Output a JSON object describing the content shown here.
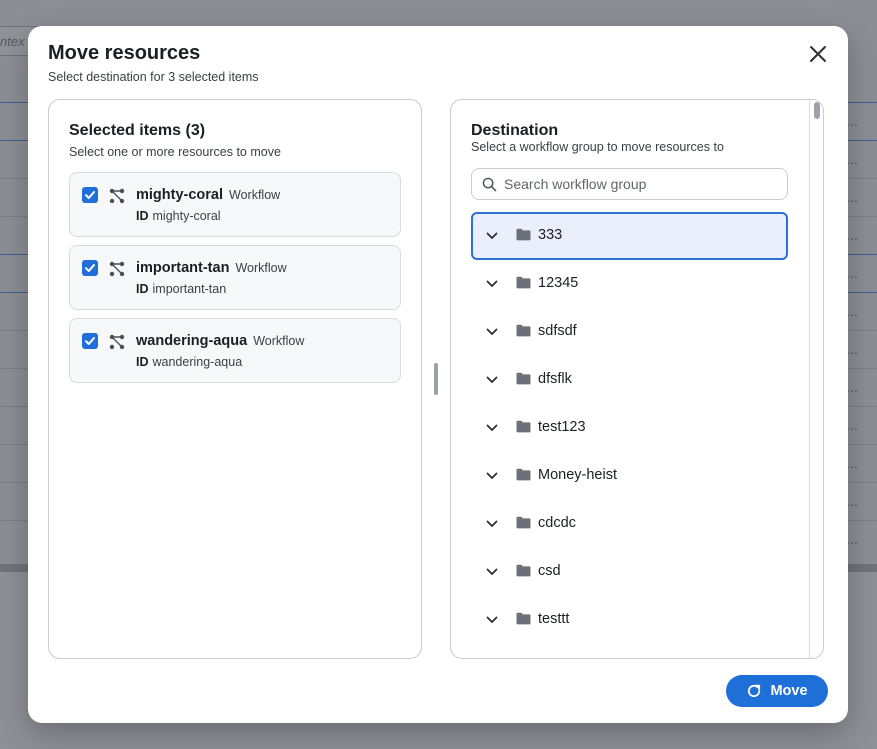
{
  "background": {
    "filter_text": "ntex"
  },
  "modal": {
    "title": "Move resources",
    "subtitle": "Select destination for 3 selected items",
    "close_icon": "close-icon"
  },
  "selected": {
    "title": "Selected items (3)",
    "subtitle": "Select one or more resources to move",
    "id_label": "ID",
    "items": [
      {
        "name": "mighty-coral",
        "type": "Workflow",
        "id": "mighty-coral",
        "checked": true
      },
      {
        "name": "important-tan",
        "type": "Workflow",
        "id": "important-tan",
        "checked": true
      },
      {
        "name": "wandering-aqua",
        "type": "Workflow",
        "id": "wandering-aqua",
        "checked": true
      }
    ]
  },
  "destination": {
    "title": "Destination",
    "subtitle": "Select a workflow group to move resources to",
    "search_placeholder": "Search workflow group",
    "groups": [
      {
        "label": "333",
        "selected": true
      },
      {
        "label": "12345",
        "selected": false
      },
      {
        "label": "sdfsdf",
        "selected": false
      },
      {
        "label": "dfsflk",
        "selected": false
      },
      {
        "label": "test123",
        "selected": false
      },
      {
        "label": "Money-heist",
        "selected": false
      },
      {
        "label": "cdcdc",
        "selected": false
      },
      {
        "label": "csd",
        "selected": false
      },
      {
        "label": "testtt",
        "selected": false
      }
    ]
  },
  "actions": {
    "move_label": "Move"
  },
  "colors": {
    "accent": "#1f6fd8",
    "selected_row_bg": "#e9f0fb",
    "selected_row_border": "#2f6fd1",
    "overlay": "#8b8e94"
  }
}
